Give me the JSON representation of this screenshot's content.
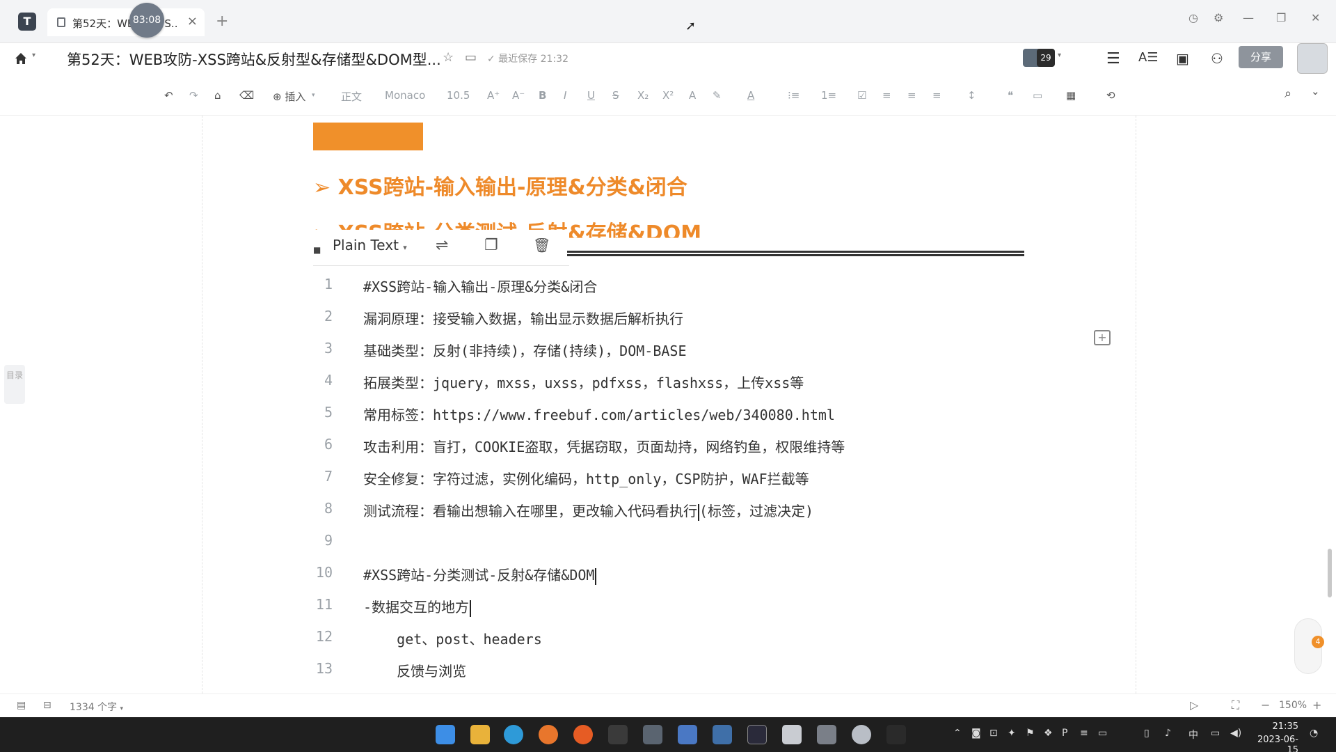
{
  "titlebar": {
    "tab_title": "第52天：WE",
    "tab_title_tail": "S...",
    "timer": "83:08",
    "tab_close": "×",
    "new_tab": "+",
    "win_controls": [
      "◷",
      "⚙",
      "—",
      "❐",
      "✕"
    ]
  },
  "header": {
    "home_caret": "▾",
    "doc_title": "第52天：WEB攻防-XSS跨站&反射型&存储型&DOM型...",
    "star": "☆",
    "folder": "▭",
    "save_status": "✓ 最近保存 21:32",
    "collab_count": "29",
    "collab_caret": "▾",
    "icons": [
      "☰",
      "A☰",
      "▣",
      "⚇"
    ],
    "share_label": "分享"
  },
  "toolbar": {
    "undo": "↶",
    "redo": "↷",
    "format_painter": "⌂",
    "eraser": "⌫",
    "insert_label": "⊕ 插入",
    "insert_caret": "▾",
    "paragraph_style": "正文",
    "font_name": "Monaco",
    "font_size": "10.5",
    "items": [
      "A⁺",
      "A⁻",
      "B",
      "I",
      "U",
      "S",
      "X₂",
      "X²",
      "A",
      "✎",
      "A",
      "⁝≡",
      "1≡",
      "☑",
      "≡",
      "≡",
      "≡",
      "↕",
      "❝",
      "▭",
      "▦",
      "⟲"
    ],
    "search": "⌕",
    "collapse": "⌄"
  },
  "document": {
    "heading1": "➢ XSS跨站-输入输出-原理&分类&闭合",
    "heading2": "➢ XSS跨站-分类测试-反射&存储&DOM",
    "code_language": "Plain Text",
    "code_language_caret": "▾",
    "code_icons": {
      "wrap": "⇌",
      "copy": "❐",
      "delete": "🗑"
    },
    "code_lines": [
      {
        "n": "1",
        "text": "#XSS跨站-输入输出-原理&分类&闭合"
      },
      {
        "n": "2",
        "text": "漏洞原理：接受输入数据，输出显示数据后解析执行"
      },
      {
        "n": "3",
        "text": "基础类型：反射(非持续)，存储(持续)，DOM-BASE"
      },
      {
        "n": "4",
        "text": "拓展类型：jquery，mxss，uxss，pdfxss，flashxss，上传xss等"
      },
      {
        "n": "5",
        "text": "常用标签：https://www.freebuf.com/articles/web/340080.html"
      },
      {
        "n": "6",
        "text": "攻击利用：盲打，COOKIE盗取，凭据窃取，页面劫持，网络钓鱼，权限维持等"
      },
      {
        "n": "7",
        "text": "安全修复：字符过滤，实例化编码，http_only，CSP防护，WAF拦截等"
      },
      {
        "n": "8",
        "text": "测试流程：看输出想输入在哪里，更改输入代码看执行",
        "tail": "(标签，过滤决定)"
      },
      {
        "n": "9",
        "text": ""
      },
      {
        "n": "10",
        "text": "#XSS跨站-分类测试-反射&存储&DOM"
      },
      {
        "n": "11",
        "text": "-数据交互的地方"
      },
      {
        "n": "12",
        "text": "    get、post、headers"
      },
      {
        "n": "13",
        "text": "    反馈与浏览"
      }
    ],
    "toc_label": "目录",
    "comment_add": "+",
    "help_badge": "4"
  },
  "statusbar": {
    "outline_icon": "▤",
    "layout_icon": "⊟",
    "word_count": "1334 个字",
    "word_count_caret": "▾",
    "play": "▷",
    "fullscreen": "⛶",
    "zoom_minus": "−",
    "zoom": "150%",
    "zoom_plus": "+"
  },
  "taskbar": {
    "tray_icons": [
      "⌃",
      "◙",
      "⊡",
      "✦",
      "⚑",
      "❖",
      "P",
      "≡",
      "▭"
    ],
    "ime": "中",
    "time": "21:35",
    "date": "2023-06-15"
  },
  "colors": {
    "accent_orange": "#f0902a",
    "heading_orange": "#ee8a2a",
    "share_button": "#8e949c",
    "taskbar": "#1f1f1f"
  }
}
